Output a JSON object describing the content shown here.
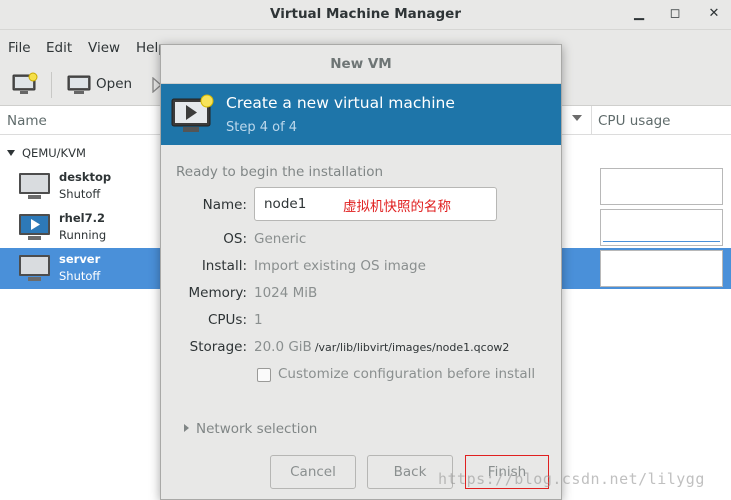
{
  "window": {
    "title": "Virtual Machine Manager"
  },
  "menu": {
    "items": [
      "File",
      "Edit",
      "View",
      "Help"
    ]
  },
  "toolbar": {
    "open_label": "Open"
  },
  "list": {
    "col_name": "Name",
    "col_cpu": "CPU usage",
    "group": "QEMU/KVM",
    "vms": [
      {
        "name": "desktop",
        "state": "Shutoff",
        "selected": false
      },
      {
        "name": "rhel7.2",
        "state": "Running",
        "selected": false
      },
      {
        "name": "server",
        "state": "Shutoff",
        "selected": true
      }
    ]
  },
  "dialog": {
    "title": "New VM",
    "heading": "Create a new virtual machine",
    "step": "Step 4 of 4",
    "section": "Ready to begin the installation",
    "labels": {
      "name": "Name:",
      "os": "OS:",
      "install": "Install:",
      "memory": "Memory:",
      "cpus": "CPUs:",
      "storage": "Storage:"
    },
    "values": {
      "name": "node1",
      "name_annotation": "虚拟机快照的名称",
      "os": "Generic",
      "install": "Import existing OS image",
      "memory": "1024 MiB",
      "cpus": "1",
      "storage_size": "20.0 GiB",
      "storage_path": "/var/lib/libvirt/images/node1.qcow2"
    },
    "customize_label": "Customize configuration before install",
    "customize_checked": false,
    "network_label": "Network selection",
    "buttons": {
      "cancel": "Cancel",
      "back": "Back",
      "finish": "Finish"
    }
  },
  "watermark": "https://blog.csdn.net/lilygg",
  "colors": {
    "banner": "#1e75a9",
    "selection": "#4a90d9",
    "annotation": "#e02020"
  }
}
